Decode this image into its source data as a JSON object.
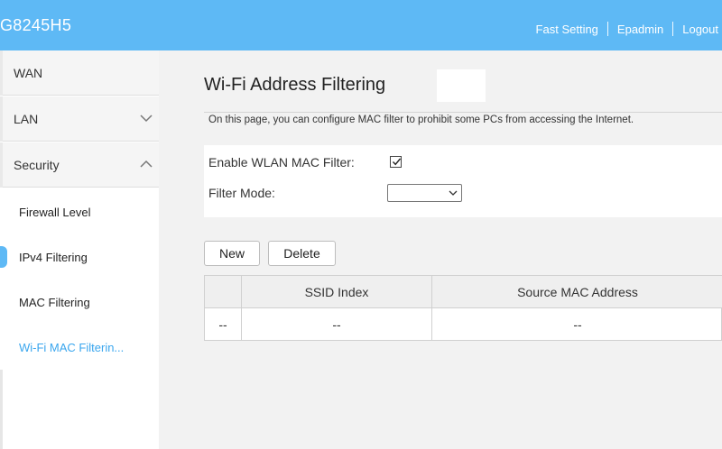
{
  "header": {
    "model": "G8245H5",
    "nav": [
      "Fast Setting",
      "Epadmin",
      "Logout"
    ]
  },
  "sidebar": {
    "items": [
      {
        "label": "WAN"
      },
      {
        "label": "LAN",
        "state": "collapsed"
      },
      {
        "label": "Security",
        "state": "expanded"
      }
    ],
    "security_sub": [
      {
        "label": "Firewall Level"
      },
      {
        "label": "IPv4 Filtering"
      },
      {
        "label": "MAC Filtering"
      },
      {
        "label": "Wi-Fi MAC Filterin..."
      }
    ],
    "active_sub": "Wi-Fi MAC Filterin..."
  },
  "main": {
    "title": "Wi-Fi Address Filtering",
    "description": "On this page, you can configure MAC filter to prohibit some PCs from accessing the Internet.",
    "enable_label": "Enable WLAN MAC Filter:",
    "enable_checked": true,
    "mode_label": "Filter Mode:",
    "mode_value": "",
    "buttons": {
      "new": "New",
      "delete": "Delete"
    },
    "table": {
      "headers": [
        "",
        "SSID Index",
        "Source MAC Address"
      ],
      "rows": [
        [
          "--",
          "--",
          "--"
        ]
      ]
    }
  },
  "colors": {
    "accent": "#5eb9f5",
    "active_link": "#3aa6ee"
  }
}
